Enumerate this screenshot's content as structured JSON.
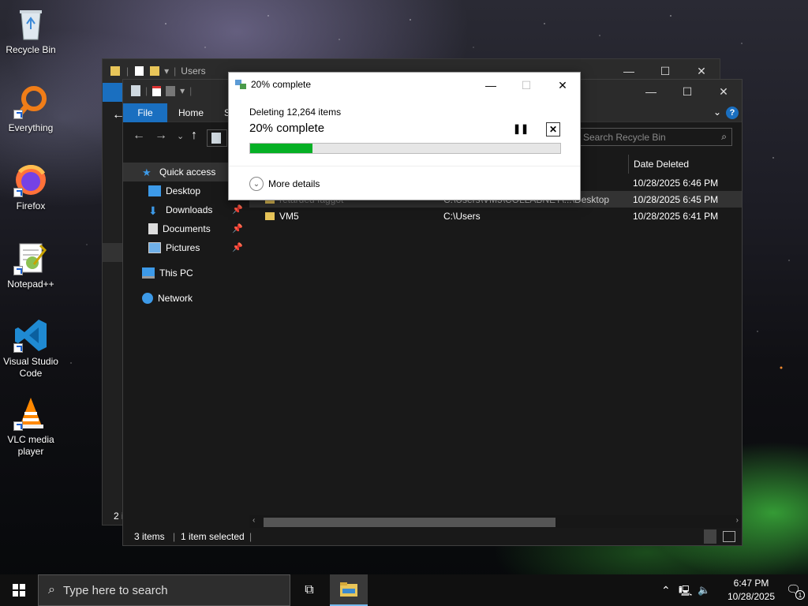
{
  "desktop": {
    "icons": [
      {
        "label": "Recycle Bin"
      },
      {
        "label": "Everything"
      },
      {
        "label": "Firefox"
      },
      {
        "label": "Notepad++"
      },
      {
        "label": "Visual Studio Code"
      },
      {
        "label": "VLC media player"
      }
    ]
  },
  "back_window": {
    "title": "Users",
    "status": "2 i"
  },
  "explorer": {
    "tabs": {
      "file": "File",
      "home": "Home",
      "share": "S"
    },
    "search_placeholder": "Search Recycle Bin",
    "sidebar": [
      {
        "label": "Quick access",
        "pinned": false
      },
      {
        "label": "Desktop",
        "pinned": false
      },
      {
        "label": "Downloads",
        "pinned": true
      },
      {
        "label": "Documents",
        "pinned": true
      },
      {
        "label": "Pictures",
        "pinned": true
      },
      {
        "label": "This PC",
        "pinned": false
      },
      {
        "label": "Network",
        "pinned": false
      }
    ],
    "column_date": "Date Deleted",
    "rows": [
      {
        "name": "",
        "location": "",
        "date": "10/28/2025 6:46 PM"
      },
      {
        "name": "retarded faggot",
        "location": "C:\\Users\\VM5\\COLLABNET\\...\\Desktop",
        "date": "10/28/2025 6:45 PM"
      },
      {
        "name": "VM5",
        "location": "C:\\Users",
        "date": "10/28/2025 6:41 PM"
      }
    ],
    "status_items": "3 items",
    "status_selected": "1 item selected"
  },
  "dialog": {
    "title": "20% complete",
    "subtitle": "Deleting 12,264 items",
    "percent_text": "20% complete",
    "progress": 0.2,
    "more_details": "More details"
  },
  "taskbar": {
    "search_placeholder": "Type here to search",
    "time": "6:47 PM",
    "date": "10/28/2025",
    "notification_count": "1"
  },
  "colors": {
    "accent": "#1a6fc0",
    "progress_fill": "#06b025",
    "folder": "#e8c559"
  }
}
